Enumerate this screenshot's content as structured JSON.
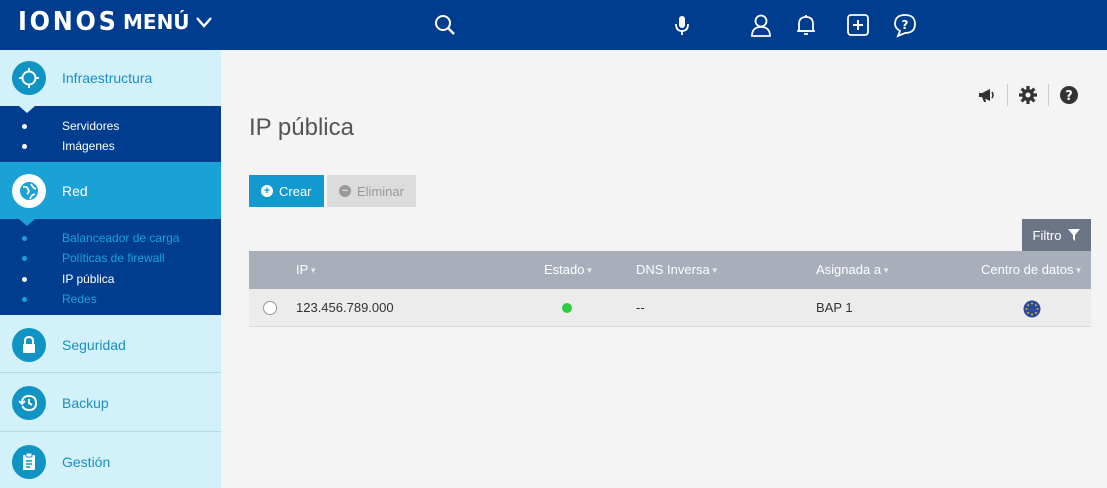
{
  "topbar": {
    "logo": "IONOS",
    "menu_label": "MENÚ",
    "icons": [
      "search-icon",
      "microphone-icon",
      "user-icon",
      "bell-icon",
      "plus-square-icon",
      "help-bubble-icon"
    ]
  },
  "sidebar": {
    "sections": [
      {
        "label": "Infraestructura",
        "icon": "infrastructure-icon",
        "subitems": [
          "Servidores",
          "Imágenes"
        ]
      },
      {
        "label": "Red",
        "icon": "network-globe-icon",
        "active": true,
        "subitems": [
          "Balanceador de carga",
          "Políticas de firewall",
          "IP pública",
          "Redes"
        ],
        "active_subitem": "IP pública"
      },
      {
        "label": "Seguridad",
        "icon": "lock-icon"
      },
      {
        "label": "Backup",
        "icon": "clock-backup-icon"
      },
      {
        "label": "Gestión",
        "icon": "clipboard-icon"
      }
    ]
  },
  "main": {
    "title": "IP pública",
    "toolbar_icons": [
      "megaphone-icon",
      "gear-icon",
      "help-circle-icon"
    ],
    "create_label": "Crear",
    "delete_label": "Eliminar",
    "filter_label": "Filtro",
    "table": {
      "columns": [
        "IP",
        "Estado",
        "DNS Inversa",
        "Asignada a",
        "Centro de datos"
      ],
      "rows": [
        {
          "ip": "123.456.789.000",
          "status_color": "#2ecc40",
          "dns": "--",
          "assigned": "BAP 1",
          "datacenter_icon": "eu-flag-icon"
        }
      ]
    }
  },
  "colors": {
    "topbar": "#003d8f",
    "sidebar_bg": "#d3f1fa",
    "active_section": "#1aa1d6",
    "accent": "#1299cf",
    "table_header": "#a8aeba"
  }
}
